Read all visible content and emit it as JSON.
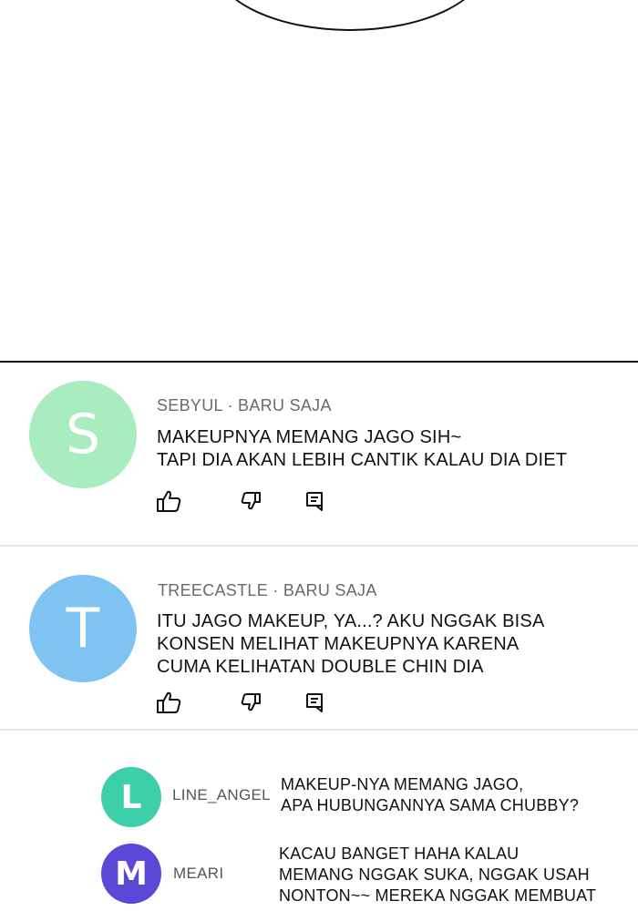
{
  "colors": {
    "avatar_s": "#a8ecbf",
    "avatar_t": "#7fc3f2",
    "avatar_l": "#3ccfa9",
    "avatar_m": "#5b48d6"
  },
  "comments": [
    {
      "initial": "S",
      "meta": "SEBYUL · BARU SAJA",
      "text": "MAKEUPNYA MEMANG JAGO SIH~\nTAPI DIA AKAN LEBIH CANTIK KALAU DIA DIET",
      "icons": [
        "thumbs-up-icon",
        "thumbs-down-icon",
        "reply-icon"
      ]
    },
    {
      "initial": "T",
      "meta": "TREECASTLE · BARU SAJA",
      "text": "ITU JAGO MAKEUP, YA...? AKU NGGAK BISA\nKONSEN MELIHAT MAKEUPNYA KARENA\nCUMA KELIHATAN DOUBLE CHIN DIA",
      "icons": [
        "thumbs-up-icon",
        "thumbs-down-icon",
        "reply-icon"
      ]
    }
  ],
  "replies": [
    {
      "initial": "L",
      "name": "LINE_ANGEL",
      "text": "MAKEUP-NYA MEMANG JAGO,\nAPA HUBUNGANNYA SAMA CHUBBY?"
    },
    {
      "initial": "M",
      "name": "MEARI",
      "text": "KACAU BANGET HAHA KALAU\nMEMANG NGGAK SUKA, NGGAK USAH\nNONTON~~ MEREKA NGGAK MEMBUAT"
    }
  ]
}
